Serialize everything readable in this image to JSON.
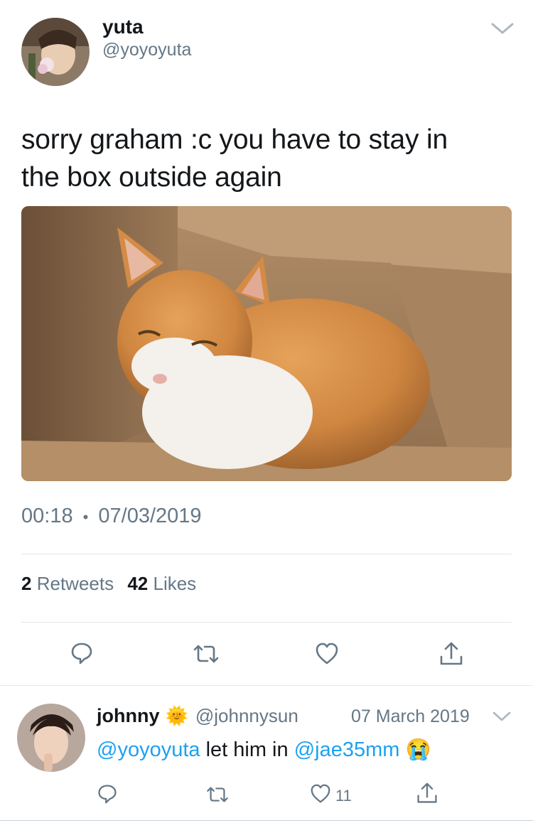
{
  "tweet": {
    "author_name": "yuta",
    "author_handle": "@yoyoyuta",
    "text_line1": "sorry graham :c you have to stay in",
    "text_line2": "the box outside again",
    "time": "00:18",
    "separator": "•",
    "date": "07/03/2019",
    "retweets_count": "2",
    "retweets_label": "Retweets",
    "likes_count": "42",
    "likes_label": "Likes"
  },
  "actions": {
    "reply_icon": "reply-icon",
    "retweet_icon": "retweet-icon",
    "like_icon": "heart-icon",
    "share_icon": "share-icon"
  },
  "reply": {
    "author_name": "johnny",
    "badge_emoji": "🌞",
    "author_handle": "@johnnysun",
    "date": "07 March 2019",
    "mention1": "@yoyoyuta",
    "middle_text": "let him in",
    "mention2": "@jae35mm",
    "emoji": "😭",
    "like_count": "11"
  },
  "colors": {
    "accent": "#1da1f2",
    "secondary_text": "#657786",
    "divider": "#e1e8ed"
  }
}
